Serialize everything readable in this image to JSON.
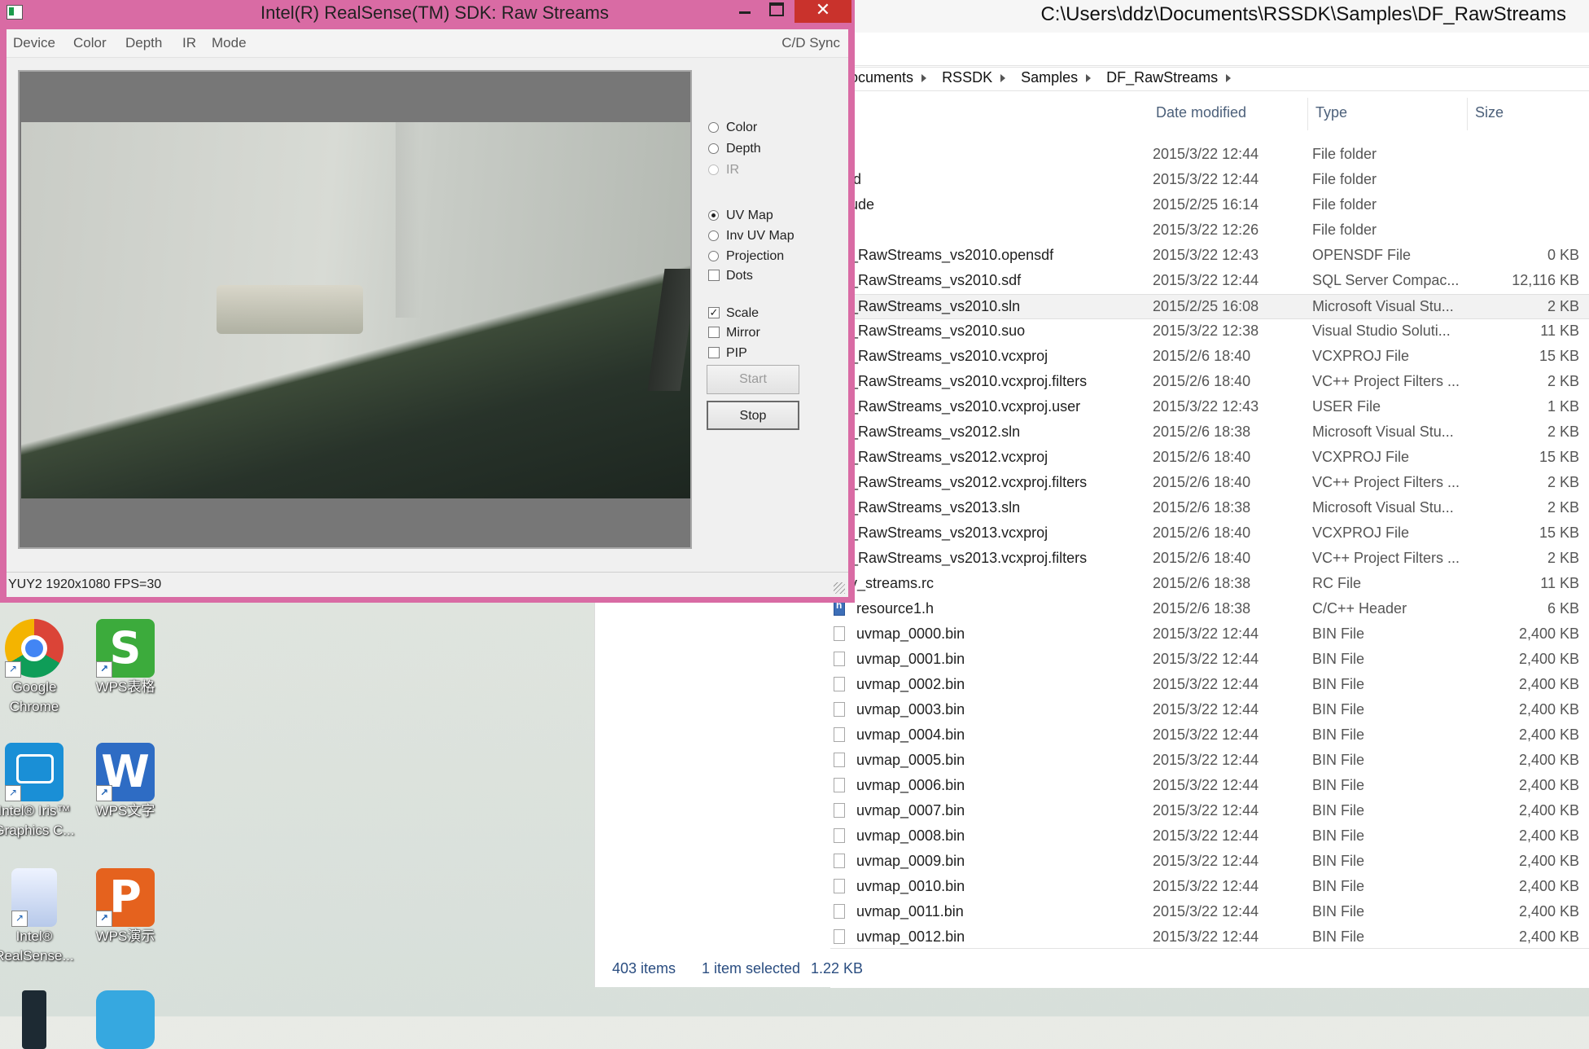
{
  "explorer": {
    "title": "C:\\Users\\ddz\\Documents\\RSSDK\\Samples\\DF_RawStreams",
    "breadcrumb": [
      "ocuments",
      "RSSDK",
      "Samples",
      "DF_RawStreams"
    ],
    "columns": {
      "date": "Date modified",
      "type": "Type",
      "size": "Size"
    },
    "files": [
      {
        "name": "",
        "date": "2015/3/22 12:44",
        "type": "File folder",
        "size": ""
      },
      {
        "name": "ld",
        "date": "2015/3/22 12:44",
        "type": "File folder",
        "size": ""
      },
      {
        "name": "ude",
        "date": "2015/2/25 16:14",
        "type": "File folder",
        "size": ""
      },
      {
        "name": "",
        "date": "2015/3/22 12:26",
        "type": "File folder",
        "size": ""
      },
      {
        "name": "_RawStreams_vs2010.opensdf",
        "date": "2015/3/22 12:43",
        "type": "OPENSDF File",
        "size": "0 KB"
      },
      {
        "name": "_RawStreams_vs2010.sdf",
        "date": "2015/3/22 12:44",
        "type": "SQL Server Compac...",
        "size": "12,116 KB"
      },
      {
        "name": "_RawStreams_vs2010.sln",
        "date": "2015/2/25 16:08",
        "type": "Microsoft Visual Stu...",
        "size": "2 KB"
      },
      {
        "name": "_RawStreams_vs2010.suo",
        "date": "2015/3/22 12:38",
        "type": "Visual Studio Soluti...",
        "size": "11 KB"
      },
      {
        "name": "_RawStreams_vs2010.vcxproj",
        "date": "2015/2/6 18:40",
        "type": "VCXPROJ File",
        "size": "15 KB"
      },
      {
        "name": "_RawStreams_vs2010.vcxproj.filters",
        "date": "2015/2/6 18:40",
        "type": "VC++ Project Filters ...",
        "size": "2 KB"
      },
      {
        "name": "_RawStreams_vs2010.vcxproj.user",
        "date": "2015/3/22 12:43",
        "type": "USER File",
        "size": "1 KB"
      },
      {
        "name": "_RawStreams_vs2012.sln",
        "date": "2015/2/6 18:38",
        "type": "Microsoft Visual Stu...",
        "size": "2 KB"
      },
      {
        "name": "_RawStreams_vs2012.vcxproj",
        "date": "2015/2/6 18:40",
        "type": "VCXPROJ File",
        "size": "15 KB"
      },
      {
        "name": "_RawStreams_vs2012.vcxproj.filters",
        "date": "2015/2/6 18:40",
        "type": "VC++ Project Filters ...",
        "size": "2 KB"
      },
      {
        "name": "_RawStreams_vs2013.sln",
        "date": "2015/2/6 18:38",
        "type": "Microsoft Visual Stu...",
        "size": "2 KB"
      },
      {
        "name": "_RawStreams_vs2013.vcxproj",
        "date": "2015/2/6 18:40",
        "type": "VCXPROJ File",
        "size": "15 KB"
      },
      {
        "name": "_RawStreams_vs2013.vcxproj.filters",
        "date": "2015/2/6 18:40",
        "type": "VC++ Project Filters ...",
        "size": "2 KB"
      },
      {
        "name": "v_streams.rc",
        "date": "2015/2/6 18:38",
        "type": "RC File",
        "size": "11 KB"
      },
      {
        "name": "resource1.h",
        "date": "2015/2/6 18:38",
        "type": "C/C++ Header",
        "size": "6 KB"
      },
      {
        "name": "uvmap_0000.bin",
        "date": "2015/3/22 12:44",
        "type": "BIN File",
        "size": "2,400 KB"
      },
      {
        "name": "uvmap_0001.bin",
        "date": "2015/3/22 12:44",
        "type": "BIN File",
        "size": "2,400 KB"
      },
      {
        "name": "uvmap_0002.bin",
        "date": "2015/3/22 12:44",
        "type": "BIN File",
        "size": "2,400 KB"
      },
      {
        "name": "uvmap_0003.bin",
        "date": "2015/3/22 12:44",
        "type": "BIN File",
        "size": "2,400 KB"
      },
      {
        "name": "uvmap_0004.bin",
        "date": "2015/3/22 12:44",
        "type": "BIN File",
        "size": "2,400 KB"
      },
      {
        "name": "uvmap_0005.bin",
        "date": "2015/3/22 12:44",
        "type": "BIN File",
        "size": "2,400 KB"
      },
      {
        "name": "uvmap_0006.bin",
        "date": "2015/3/22 12:44",
        "type": "BIN File",
        "size": "2,400 KB"
      },
      {
        "name": "uvmap_0007.bin",
        "date": "2015/3/22 12:44",
        "type": "BIN File",
        "size": "2,400 KB"
      },
      {
        "name": "uvmap_0008.bin",
        "date": "2015/3/22 12:44",
        "type": "BIN File",
        "size": "2,400 KB"
      },
      {
        "name": "uvmap_0009.bin",
        "date": "2015/3/22 12:44",
        "type": "BIN File",
        "size": "2,400 KB"
      },
      {
        "name": "uvmap_0010.bin",
        "date": "2015/3/22 12:44",
        "type": "BIN File",
        "size": "2,400 KB"
      },
      {
        "name": "uvmap_0011.bin",
        "date": "2015/3/22 12:44",
        "type": "BIN File",
        "size": "2,400 KB"
      },
      {
        "name": "uvmap_0012.bin",
        "date": "2015/3/22 12:44",
        "type": "BIN File",
        "size": "2,400 KB"
      }
    ],
    "status": {
      "items": "403 items",
      "selected": "1 item selected",
      "selected_size": "1.22 KB"
    }
  },
  "realsense": {
    "title": "Intel(R) RealSense(TM) SDK: Raw Streams",
    "close": "✕",
    "menu": [
      "Device",
      "Color",
      "Depth",
      "IR",
      "Mode"
    ],
    "cd_sync": "C/D Sync",
    "streams": [
      {
        "label": "Color",
        "selected": false,
        "enabled": true
      },
      {
        "label": "Depth",
        "selected": false,
        "enabled": true
      },
      {
        "label": "IR",
        "selected": false,
        "enabled": false
      }
    ],
    "modes": [
      {
        "label": "UV Map",
        "selected": true
      },
      {
        "label": "Inv UV Map",
        "selected": false
      },
      {
        "label": "Projection",
        "selected": false
      }
    ],
    "checks": [
      {
        "label": "Dots",
        "checked": false
      },
      {
        "label": "Scale",
        "checked": true
      },
      {
        "label": "Mirror",
        "checked": false
      },
      {
        "label": "PIP",
        "checked": false
      }
    ],
    "start_label": "Start",
    "stop_label": "Stop",
    "status": "YUY2 1920x1080 FPS=30"
  },
  "desktop": {
    "icons": [
      {
        "label1": "Google",
        "label2": "Chrome",
        "glyph": ""
      },
      {
        "label1": "WPS表格",
        "label2": "",
        "glyph": "S"
      },
      {
        "label1": "Intel® Iris™",
        "label2": "Graphics C...",
        "glyph": ""
      },
      {
        "label1": "WPS文字",
        "label2": "",
        "glyph": "W"
      },
      {
        "label1": "Intel®",
        "label2": "RealSense...",
        "glyph": ""
      },
      {
        "label1": "WPS演示",
        "label2": "",
        "glyph": "P"
      }
    ]
  }
}
